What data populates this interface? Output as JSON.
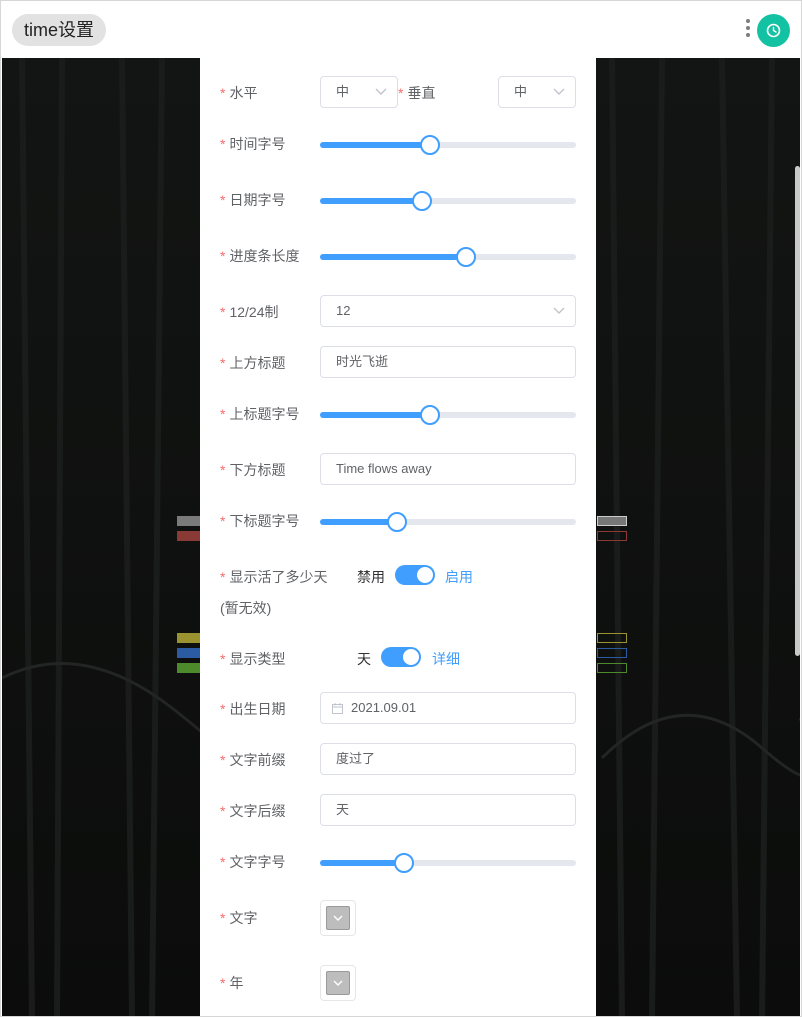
{
  "header": {
    "title": "time设置",
    "menu_icon": "vertical-dots-icon",
    "logo_icon": "app-logo-icon",
    "accent": "#13c2a3"
  },
  "form": {
    "required_mark": "*",
    "horizontal": {
      "label": "水平",
      "value": "中"
    },
    "vertical": {
      "label": "垂直",
      "value": "中"
    },
    "time_font_size": {
      "label": "时间字号",
      "percent": 43
    },
    "date_font_size": {
      "label": "日期字号",
      "percent": 40
    },
    "progress_length": {
      "label": "进度条长度",
      "percent": 57
    },
    "hour_format": {
      "label": "12/24制",
      "value": "12"
    },
    "top_title": {
      "label": "上方标题",
      "value": "时光飞逝"
    },
    "top_title_size": {
      "label": "上标题字号",
      "percent": 43
    },
    "bottom_title": {
      "label": "下方标题",
      "value": "Time flows away"
    },
    "bottom_title_size": {
      "label": "下标题字号",
      "percent": 30
    },
    "show_days_lived": {
      "label": "显示活了多少天",
      "note": "(暂无效)",
      "off_label": "禁用",
      "on_label": "启用",
      "checked": true
    },
    "display_type": {
      "label": "显示类型",
      "off_label": "天",
      "on_label": "详细",
      "checked": true
    },
    "birth_date": {
      "label": "出生日期",
      "value": "2021.09.01",
      "icon": "calendar-icon"
    },
    "text_prefix": {
      "label": "文字前缀",
      "value": "度过了"
    },
    "text_suffix": {
      "label": "文字后缀",
      "value": "天"
    },
    "text_font_size": {
      "label": "文字字号",
      "percent": 33
    },
    "text_color": {
      "label": "文字"
    },
    "year_color": {
      "label": "年"
    }
  },
  "colors": {
    "primary": "#409eff",
    "required": "#f56c6c",
    "background": "#0f1110"
  }
}
